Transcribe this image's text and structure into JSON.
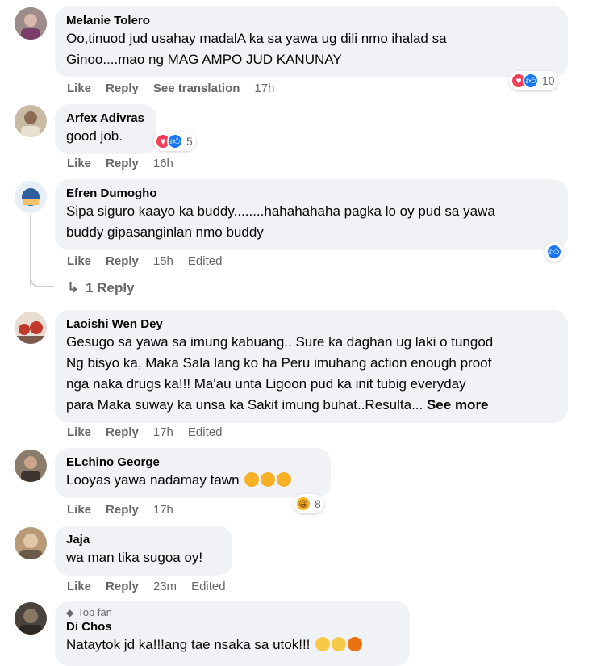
{
  "actions": {
    "like": "Like",
    "reply": "Reply",
    "see_translation": "See translation",
    "edited": "Edited",
    "see_more": "See more"
  },
  "comments": [
    {
      "name": "Melanie Tolero",
      "text_lines": [
        "Oo,tinuod jud usahay madalA ka sa yawa ug dili nmo ihalad sa",
        "Ginoo....mao ng MAG AMPO JUD KANUNAY"
      ],
      "time": "17h",
      "reactions": {
        "icons": [
          "heart-icon",
          "like-icon"
        ],
        "count": "10"
      },
      "avatar_color": "#8a7a86"
    },
    {
      "name": "Arfex Adivras",
      "text_lines": [
        "good job."
      ],
      "time": "16h",
      "reactions": {
        "icons": [
          "heart-icon",
          "like-icon"
        ],
        "count": "5"
      },
      "avatar_color": "#b5a287"
    },
    {
      "name": "Efren Dumogho",
      "text_lines": [
        "Sipa siguro kaayo ka buddy........hahahahaha pagka lo oy pud sa yawa",
        "buddy gipasanginlan nmo buddy"
      ],
      "time": "15h",
      "reactions": {
        "icons": [
          "like-icon"
        ],
        "count": ""
      },
      "replies": "1 Reply",
      "avatar_color": "#3d6ea8"
    },
    {
      "name": "Laoishi Wen Dey",
      "text_lines": [
        "Gesugo sa yawa sa imung kabuang.. Sure ka daghan ug laki o tungod",
        "Ng bisyo ka, Maka Sala lang ko ha Peru imuhang action enough proof",
        "nga naka drugs ka!!! Ma'au unta Ligoon pud ka init tubig everyday",
        "para Maka suway ka unsa ka Sakit imung buhat..Resulta..."
      ],
      "time": "17h",
      "avatar_color": "#b8463a"
    },
    {
      "name": "ELchino George",
      "text_lines": [
        "Looyas yawa nadamay tawn"
      ],
      "time": "17h",
      "reactions": {
        "icons": [
          "haha-icon"
        ],
        "count": "8"
      },
      "avatar_color": "#6b5a4a"
    },
    {
      "name": "Jaja",
      "text_lines": [
        "wa man tika sugoa oy!"
      ],
      "time": "23m",
      "avatar_color": "#9a8266"
    },
    {
      "name": "Di Chos",
      "badge": "Top fan",
      "text_lines": [
        "Nataytok jd ka!!!ang tae nsaka sa utok!!!"
      ],
      "avatar_color": "#5a5046"
    }
  ]
}
